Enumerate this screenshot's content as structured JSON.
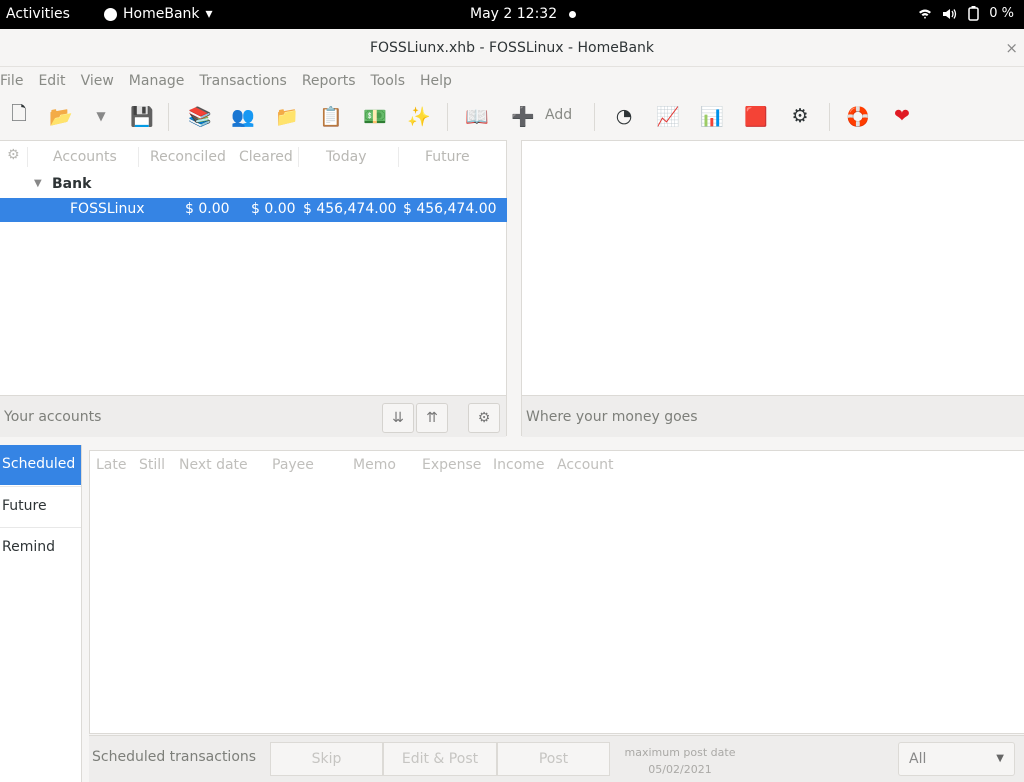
{
  "topbar": {
    "activities": "Activities",
    "app_name": "HomeBank",
    "app_menu_arrow": "▾",
    "clock": "May 2  12:32",
    "battery": "0 %"
  },
  "window": {
    "title": "FOSSLiunx.xhb - FOSSLinux - HomeBank",
    "close_glyph": "×"
  },
  "menu": [
    "File",
    "Edit",
    "View",
    "Manage",
    "Transactions",
    "Reports",
    "Tools",
    "Help"
  ],
  "toolbar": {
    "add_label": "Add",
    "icons": {
      "new": "🗋",
      "open": "📂",
      "open_dropdown": "▼",
      "save": "💾",
      "accounts": "📚",
      "payees": "👥",
      "categories": "📁",
      "scheduled": "📋",
      "budget": "💵",
      "assistant": "✨",
      "show_account": "📖",
      "add": "➕",
      "stats": "◔",
      "trend": "📈",
      "balance": "📊",
      "budget_report": "🟥",
      "vehicle": "⚙",
      "help": "🛟",
      "donate": "❤"
    }
  },
  "accounts": {
    "columns": [
      "Accounts",
      "Reconciled",
      "Cleared",
      "Today",
      "Future"
    ],
    "group": "Bank",
    "rows": [
      {
        "name": "FOSSLinux",
        "reconciled": "$ 0.00",
        "cleared": "$ 0.00",
        "today": "$ 456,474.00",
        "future": "$ 456,474.00"
      }
    ],
    "footer_label": "Your accounts",
    "icons": {
      "settings": "⚙",
      "expand": "⇊",
      "collapse": "⇈",
      "tri": "▼"
    }
  },
  "money": {
    "footer_label": "Where your money goes"
  },
  "scheduled": {
    "tabs": [
      "Scheduled",
      "Future",
      "Remind"
    ],
    "columns": [
      "Late",
      "Still",
      "Next date",
      "Payee",
      "Memo",
      "Expense",
      "Income",
      "Account"
    ],
    "footer_label": "Scheduled transactions",
    "skip": "Skip",
    "edit_post": "Edit & Post",
    "post": "Post",
    "max_post_label": "maximum post date",
    "max_post_date": "05/02/2021",
    "filter_value": "All",
    "filter_arrow": "▼"
  },
  "colors": {
    "selection": "#3584e4",
    "topbar": "#000000"
  }
}
